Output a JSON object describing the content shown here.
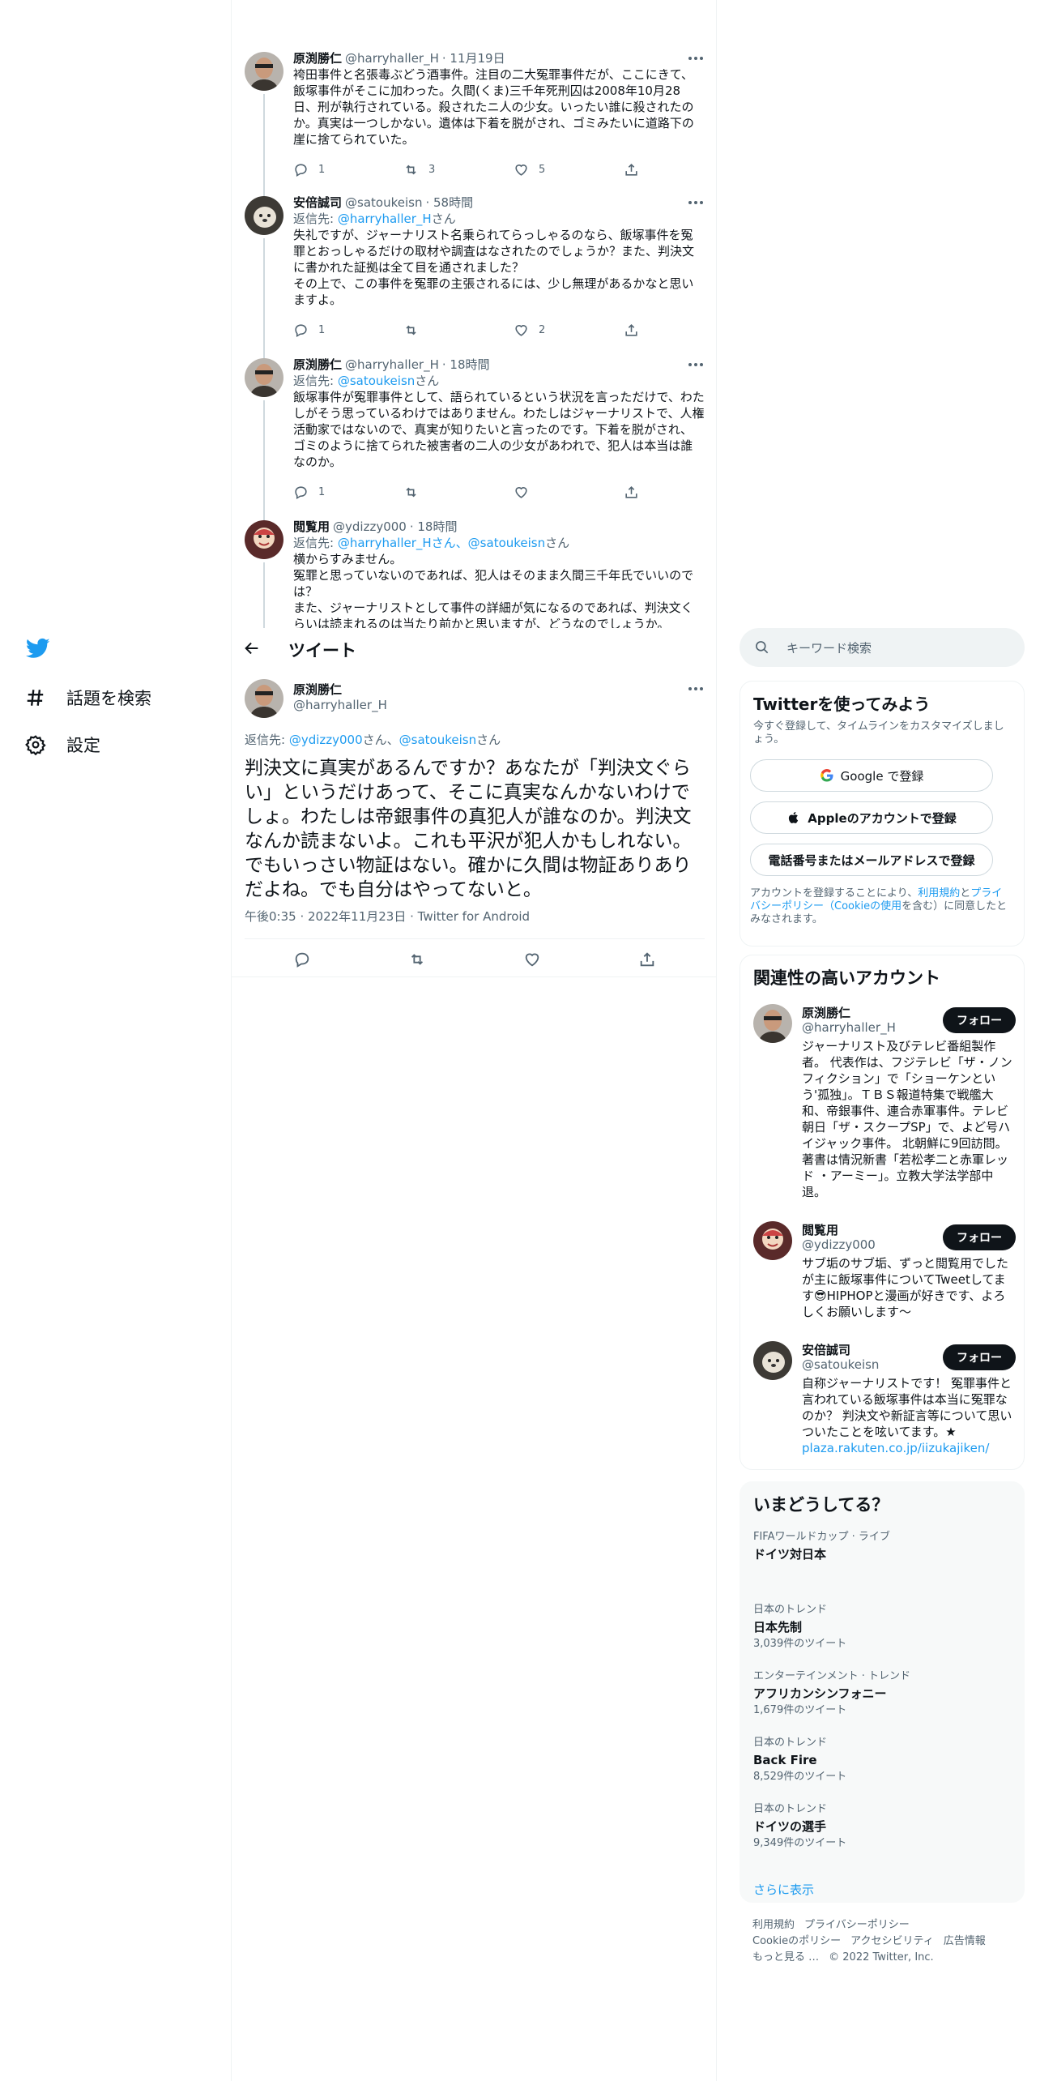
{
  "colors": {
    "accent": "#1d9bf0",
    "text": "#0f1419",
    "muted": "#536471",
    "border": "#eff3f4"
  },
  "nav": {
    "logo_icon": "twitter-bird-icon",
    "items": [
      {
        "icon": "hashtag-icon",
        "label": "話題を検索"
      },
      {
        "icon": "gear-icon",
        "label": "設定"
      }
    ]
  },
  "thread": [
    {
      "name": "原渕勝仁",
      "handle": "@harryhaller_H",
      "date": "· 11月19日",
      "reply_prefix": "",
      "reply_to": "",
      "reply_suffix": "",
      "text": "袴田事件と名張毒ぶどう酒事件。注目の二大冤罪事件だが、ここにきて、飯塚事件がそこに加わった。久間(くま)三千年死刑囚は2008年10月28日、刑が執行されている。殺されたニ人の少女。いったい誰に殺されたのか。真実は一つしかない。遺体は下着を脱がされ、ゴミみたいに道路下の崖に捨てられていた。",
      "replies": "1",
      "retweets": "3",
      "likes": "5"
    },
    {
      "name": "安倍誠司",
      "handle": "@satoukeisn",
      "date": "· 58時間",
      "reply_prefix": "返信先: ",
      "reply_to": "@harryhaller_H",
      "reply_suffix": "さん",
      "text": "失礼ですが、ジャーナリスト名乗られてらっしゃるのなら、飯塚事件を冤罪とおっしゃるだけの取材や調査はなされたのでしょうか？また、判決文に書かれた証拠は全て目を通されました？\nその上で、この事件を冤罪の主張されるには、少し無理があるかなと思いますよ。",
      "replies": "1",
      "retweets": "",
      "likes": "2"
    },
    {
      "name": "原渕勝仁",
      "handle": "@harryhaller_H",
      "date": "· 18時間",
      "reply_prefix": "返信先: ",
      "reply_to": "@satoukeisn",
      "reply_suffix": "さん",
      "text": "飯塚事件が冤罪事件として、語られているという状況を言っただけで、わたしがそう思っているわけではありません。わたしはジャーナリストで、人権活動家ではないので、真実が知りたいと言ったのです。下着を脱がされ、ゴミのように捨てられた被害者の二人の少女があわれで、犯人は本当は誰なのか。",
      "replies": "1",
      "retweets": "",
      "likes": ""
    },
    {
      "name": "閲覧用",
      "handle": "@ydizzy000",
      "date": "· 18時間",
      "reply_prefix": "返信先: ",
      "reply_to": "@harryhaller_Hさん、@satoukeisn",
      "reply_suffix": "さん",
      "text": "横からすみません。\n冤罪と思っていないのであれば、犯人はそのまま久間三千年氏でいいのでは？\nまた、ジャーナリストとして事件の詳細が気になるのであれば、判決文くらいは読まれるのは当たり前かと思いますが、どうなのでしょうか。",
      "replies": "",
      "retweets": "",
      "likes": ""
    }
  ],
  "header": {
    "title": "ツイート"
  },
  "focal": {
    "name": "原渕勝仁",
    "handle": "@harryhaller_H",
    "reply_prefix": "返信先: ",
    "reply_to_1": "@ydizzy000",
    "reply_mid": "さん、",
    "reply_to_2": "@satoukeisn",
    "reply_suffix": "さん",
    "text": "判決文に真実があるんですか？あなたが「判決文ぐらい」というだけあって、そこに真実なんかないわけでしょ。わたしは帝銀事件の真犯人が誰なのか。判決文なんか読まないよ。これも平沢が犯人かもしれない。でもいっさい物証はない。確かに久間は物証ありありだよね。でも自分はやってないと。",
    "meta": "午後0:35 · 2022年11月23日 · Twitter for Android"
  },
  "search": {
    "placeholder": "キーワード検索"
  },
  "signup": {
    "title": "Twitterを使ってみよう",
    "subtitle": "今すぐ登録して、タイムラインをカスタマイズしましょう。",
    "google": "Google で登録",
    "apple": "Appleのアカウントで登録",
    "phone": "電話番号またはメールアドレスで登録",
    "terms_1": "アカウントを登録することにより、",
    "terms_link_1": "利用規約",
    "terms_2": "と",
    "terms_link_2": "プライバシーポリシー（Cookieの使用",
    "terms_3": "を含む）に同意したとみなされます。"
  },
  "related": {
    "title": "関連性の高いアカウント",
    "follow_label": "フォロー",
    "accounts": [
      {
        "name": "原渕勝仁",
        "handle": "@harryhaller_H",
        "bio": "ジャーナリスト及びテレビ番組製作者。 代表作は、フジテレビ「ザ・ノンフィクション」で「ショーケンという'孤独」。ＴＢＳ報道特集で戦艦大和、帝銀事件、連合赤軍事件。テレビ朝日「ザ・スクープSP」で、よど号ハイジャック事件。 北朝鮮に9回訪問。著書は情況新書「若松孝二と赤軍レッド ・アーミー」。立教大学法学部中退。",
        "link": ""
      },
      {
        "name": "閲覧用",
        "handle": "@ydizzy000",
        "bio": "サブ垢のサブ垢、ずっと閲覧用でしたが主に飯塚事件についてTweetしてます😎HIPHOPと漫画が好きです、よろしくお願いします〜",
        "link": ""
      },
      {
        "name": "安倍誠司",
        "handle": "@satoukeisn",
        "bio": "自称ジャーナリストです！ 冤罪事件と言われている飯塚事件は本当に冤罪なのか？ 判決文や新証言等について思いついたことを呟いてます。★",
        "link": "plaza.rakuten.co.jp/iizukajiken/"
      }
    ]
  },
  "trends": {
    "title": "いまどうしてる？",
    "items": [
      {
        "category": "FIFAワールドカップ · ライブ",
        "name": "ドイツ対日本",
        "count": ""
      },
      {
        "category": "日本のトレンド",
        "name": "日本先制",
        "count": "3,039件のツイート"
      },
      {
        "category": "エンターテインメント · トレンド",
        "name": "アフリカンシンフォニー",
        "count": "1,679件のツイート"
      },
      {
        "category": "日本のトレンド",
        "name": "Back Fire",
        "count": "8,529件のツイート"
      },
      {
        "category": "日本のトレンド",
        "name": "ドイツの選手",
        "count": "9,349件のツイート"
      }
    ],
    "show_more": "さらに表示"
  },
  "footer": {
    "links": [
      "利用規約",
      "プライバシーポリシー",
      "Cookieのポリシー",
      "アクセシビリティ",
      "広告情報",
      "もっと見る …"
    ],
    "copyright": "© 2022 Twitter, Inc."
  }
}
